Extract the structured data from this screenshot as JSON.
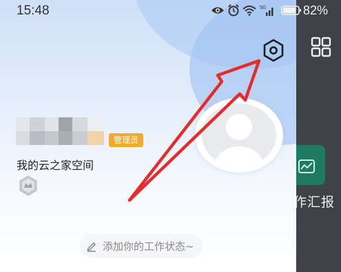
{
  "status_bar": {
    "time": "15:48",
    "battery_percent": "82%",
    "signal_label": "5G",
    "icons": [
      "eye-icon",
      "alarm-icon",
      "wifi-icon",
      "signal-icon",
      "battery-icon"
    ]
  },
  "profile": {
    "role_badge": "管理员",
    "space_name": "我的云之家空间",
    "work_status_placeholder": "添加你的工作状态~"
  },
  "background_app": {
    "partial_label": "作汇报"
  },
  "colors": {
    "badge_bg": "#f5a935",
    "annotation_arrow": "#e52b2b",
    "overlay": "#3f4246",
    "tile_green": "#1f7a63"
  }
}
